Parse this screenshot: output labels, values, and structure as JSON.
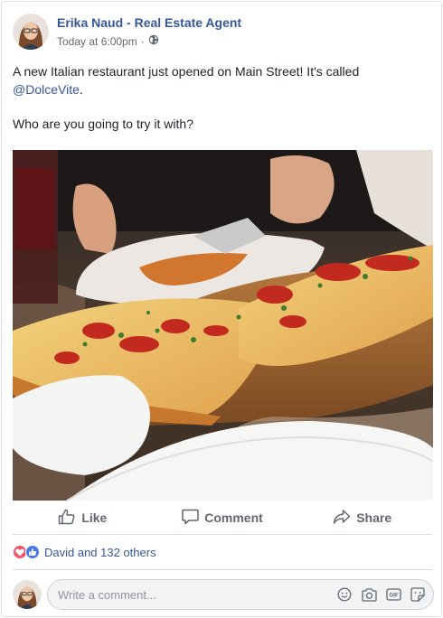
{
  "post": {
    "author": "Erika Naud - Real Estate Agent",
    "timestamp": "Today at 6:00pm",
    "privacy_icon": "globe-icon",
    "text_line1_prefix": "A new Italian restaurant just opened on Main Street! It's called ",
    "mention": "@DolceVite",
    "text_line1_suffix": ".",
    "text_line2": "Who are you going to try it with?",
    "photo_subject": "pizza-photo"
  },
  "actions": {
    "like_label": "Like",
    "comment_label": "Comment",
    "share_label": "Share"
  },
  "reactions": {
    "icons": [
      "love-icon",
      "like-icon"
    ],
    "summary": "David and 132 others"
  },
  "comment_box": {
    "placeholder": "Write a comment...",
    "icons": [
      "emoji-icon",
      "camera-icon",
      "gif-icon",
      "sticker-icon"
    ]
  },
  "colors": {
    "link": "#365899",
    "secondary_text": "#616770",
    "love": "#f25268",
    "like": "#4b77e8"
  }
}
